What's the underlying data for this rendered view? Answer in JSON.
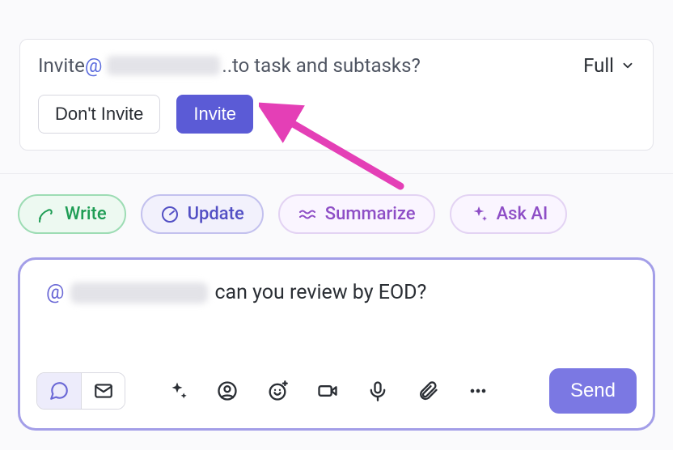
{
  "invite": {
    "prefix": "Invite ",
    "at": "@",
    "suffix_dots": "..",
    "suffix": " to task and subtasks?",
    "scope_label": "Full",
    "dont_invite": "Don't Invite",
    "invite": "Invite"
  },
  "pills": {
    "write": "Write",
    "update": "Update",
    "summarize": "Summarize",
    "ask_ai": "Ask AI"
  },
  "comment": {
    "at": "@",
    "text": " can you review by EOD?",
    "send": "Send"
  },
  "colors": {
    "primary": "#5b5bd6",
    "pill_green": "#1f9d55",
    "pill_purple": "#8e4ec6",
    "arrow": "#e43fb6"
  }
}
